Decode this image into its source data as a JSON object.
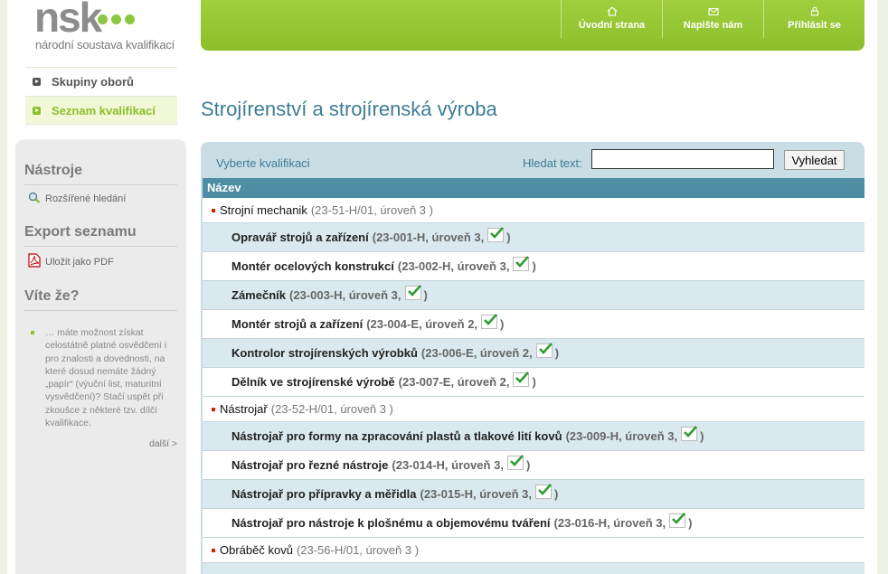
{
  "logo": {
    "name": "nsk",
    "subtitle": "národní soustava kvalifikací"
  },
  "topnav": [
    {
      "label": "Úvodní strana",
      "icon": "home-icon"
    },
    {
      "label": "Napište nám",
      "icon": "mail-icon"
    },
    {
      "label": "Přihlásit se",
      "icon": "lock-icon"
    }
  ],
  "leftmenu": [
    {
      "label": "Skupiny oborů",
      "active": false
    },
    {
      "label": "Seznam kvalifikací",
      "active": true
    }
  ],
  "leftpanel": {
    "tools_heading": "Nástroje",
    "advanced_search": "Rozšířené hledání",
    "export_heading": "Export seznamu",
    "save_pdf": "Uložit jako PDF",
    "tip_heading": "Víte že?",
    "tip_text": "… máte možnost získat celostátně platné osvědčení i pro znalosti a dovednosti, na které dosud nemáte žádný „papír“ (výuční list, maturitní vysvědčení)? Stačí uspět při zkoušce z některé tzv. dílčí kvalifikace.",
    "more": "další >"
  },
  "main": {
    "title": "Strojírenství a strojírenská výroba",
    "select_label": "Vyberte kvalifikaci",
    "search_label": "Hledat text:",
    "search_value": "",
    "search_button": "Vyhledat",
    "column_header": "Název",
    "rows": [
      {
        "type": "group",
        "name": "Strojní mechanik",
        "code": "(23-51-H/01, úroveň 3 )"
      },
      {
        "type": "item",
        "name": "Opravář strojů a zařízení",
        "code": "(23-001-H, úroveň 3,",
        "end": ")"
      },
      {
        "type": "item",
        "name": "Montér ocelových konstrukcí",
        "code": "(23-002-H, úroveň 3,",
        "end": ")"
      },
      {
        "type": "item",
        "name": "Zámečník",
        "code": "(23-003-H, úroveň 3,",
        "end": ")"
      },
      {
        "type": "item",
        "name": "Montér strojů a zařízení",
        "code": "(23-004-E, úroveň 2,",
        "end": ")"
      },
      {
        "type": "item",
        "name": "Kontrolor strojírenských výrobků",
        "code": "(23-006-E, úroveň 2,",
        "end": ")"
      },
      {
        "type": "item",
        "name": "Dělník ve strojírenské výrobě",
        "code": "(23-007-E, úroveň 2,",
        "end": ")"
      },
      {
        "type": "group",
        "name": "Nástrojař",
        "code": "(23-52-H/01, úroveň 3 )"
      },
      {
        "type": "item",
        "name": "Nástrojař pro formy na zpracování plastů a tlakové lití kovů",
        "code": "(23-009-H, úroveň 3,",
        "end": ")"
      },
      {
        "type": "item",
        "name": "Nástrojař pro řezné nástroje",
        "code": "(23-014-H, úroveň 3,",
        "end": ")"
      },
      {
        "type": "item",
        "name": "Nástrojař pro přípravky a měřidla",
        "code": "(23-015-H, úroveň 3,",
        "end": ")"
      },
      {
        "type": "item",
        "name": "Nástrojař pro nástroje k plošnému a objemovému tváření",
        "code": "(23-016-H, úroveň 3,",
        "end": ")"
      },
      {
        "type": "group",
        "name": "Obráběč kovů",
        "code": "(23-56-H/01, úroveň 3 )"
      }
    ]
  },
  "colors": {
    "accent_green": "#8cbf2a",
    "title_blue": "#3d7c94",
    "table_header": "#4e8ea4"
  }
}
